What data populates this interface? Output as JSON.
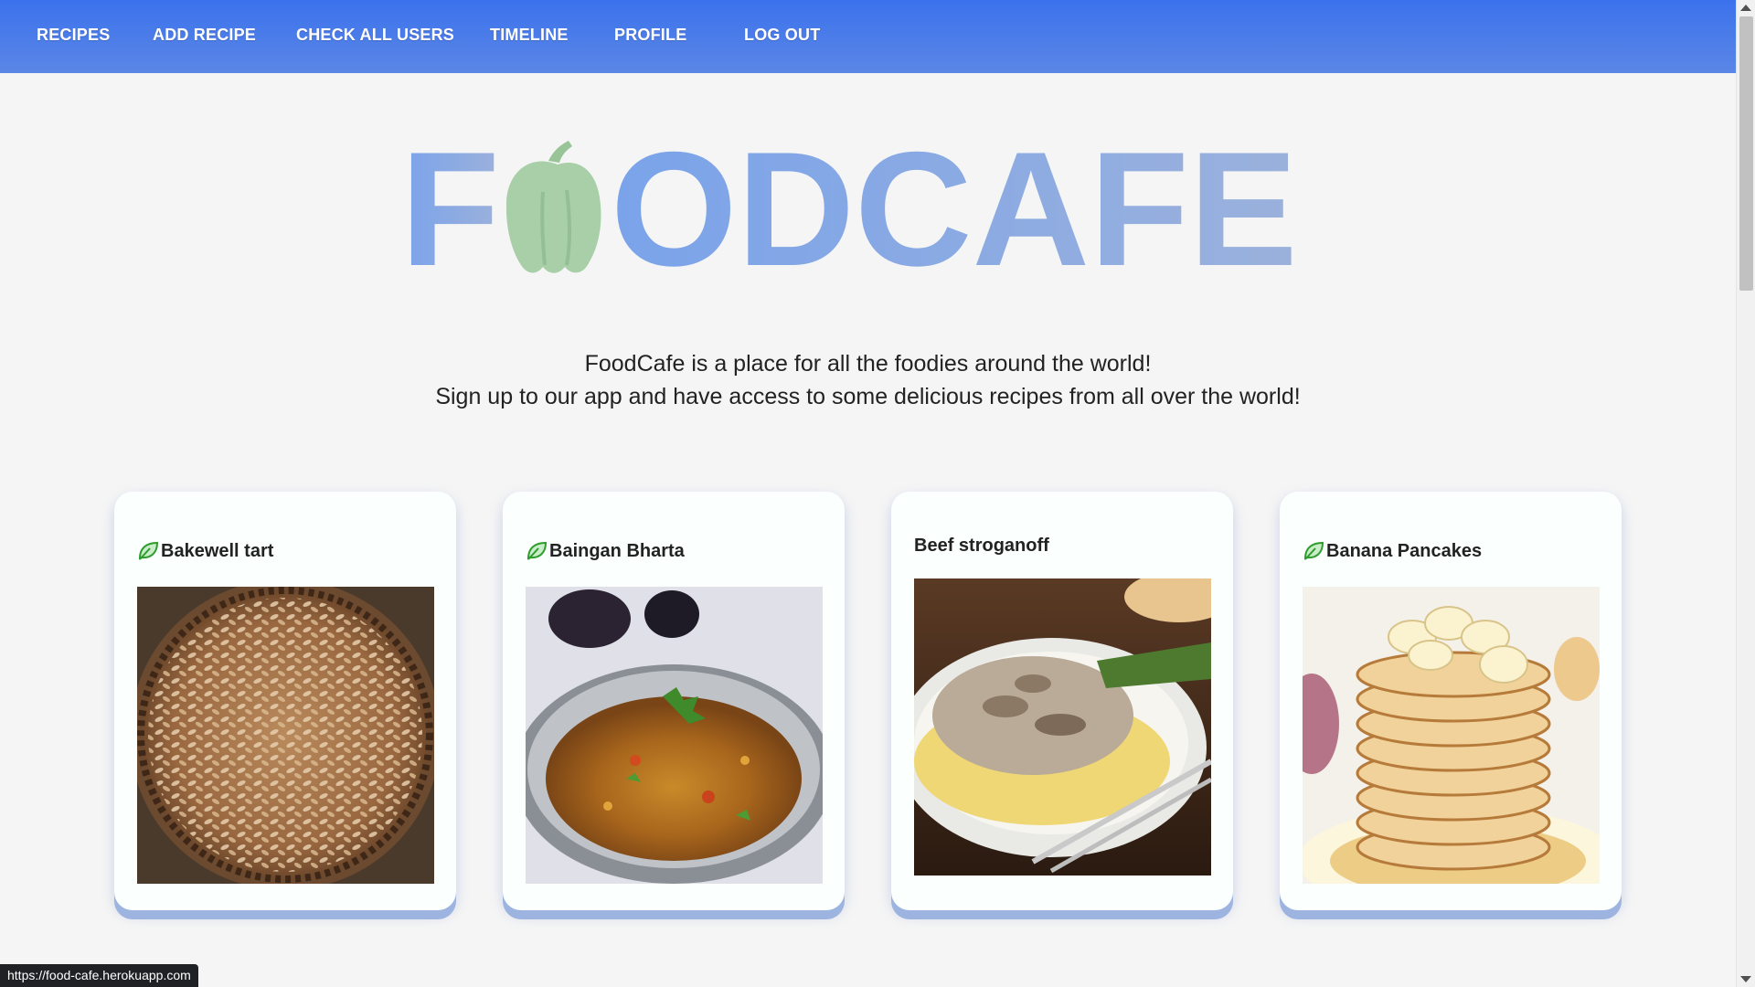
{
  "nav": {
    "recipes": "RECIPES",
    "add_recipe": "ADD RECIPE",
    "check_all_users": "CHECK ALL USERS",
    "timeline": "TIMELINE",
    "profile": "PROFILE",
    "log_out": "LOG OUT"
  },
  "logo": {
    "text_prefix": "F",
    "text_suffix": "ODCAFE",
    "icon": "bell-pepper-icon"
  },
  "tagline": {
    "line1": "FoodCafe is a place for all the foodies around the world!",
    "line2": "Sign up to our app and have access to some delicious recipes from all over the world!"
  },
  "recipes": [
    {
      "title": "Bakewell tart",
      "vegetarian": true,
      "icon": "leaf-icon"
    },
    {
      "title": "Baingan Bharta",
      "vegetarian": true,
      "icon": "leaf-icon"
    },
    {
      "title": "Beef stroganoff",
      "vegetarian": false
    },
    {
      "title": "Banana Pancakes",
      "vegetarian": true,
      "icon": "leaf-icon"
    }
  ],
  "status_bar": {
    "url": "https://food-cafe.herokuapp.com"
  },
  "colors": {
    "nav_gradient_top": "#3b72ec",
    "nav_gradient_bottom": "#5b86e6",
    "logo_letters": "#7ea3e6",
    "logo_pepper": "#a8cfa8",
    "leaf": "#2e9d2e",
    "card_shadow": "#9db3e0"
  }
}
